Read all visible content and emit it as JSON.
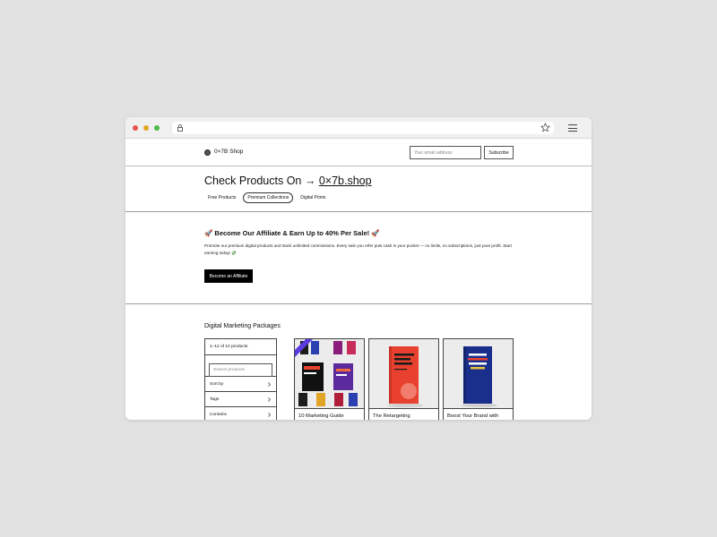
{
  "browser": {
    "url": ""
  },
  "header": {
    "brand": "0×7B Shop",
    "email_placeholder": "Your email address",
    "subscribe_label": "Subscribe"
  },
  "hero": {
    "title_prefix": "Check Products On → ",
    "title_link": "0×7b.shop",
    "tabs": [
      {
        "label": "Free Products",
        "active": false
      },
      {
        "label": "Premium Collections",
        "active": true
      },
      {
        "label": "Digital Prints",
        "active": false
      }
    ]
  },
  "affiliate": {
    "title": "🚀 Become Our Affiliate & Earn Up to 40% Per Sale! 🚀",
    "description": "Promote our premium digital products and stack unlimited commissions. Every sale you refer puts cash in your pocket — no limits, no subscriptions, just pure profit. Start earning today! 💸",
    "button_label": "Become an Affiliate"
  },
  "packages": {
    "title": "Digital Marketing Packages",
    "count_label": "1–12 of 12 products",
    "search_placeholder": "Search products",
    "filters": [
      "Sort by",
      "Tags",
      "Contains"
    ],
    "products": [
      {
        "title": "10 Marketing Guide"
      },
      {
        "title": "The Retargeting"
      },
      {
        "title": "Boost Your Brand with"
      }
    ]
  },
  "colors": {
    "accent_dark": "#000000",
    "badge_purple": "#5b3ce0",
    "book_red": "#e8412f",
    "book_blue": "#1a2f8c"
  }
}
